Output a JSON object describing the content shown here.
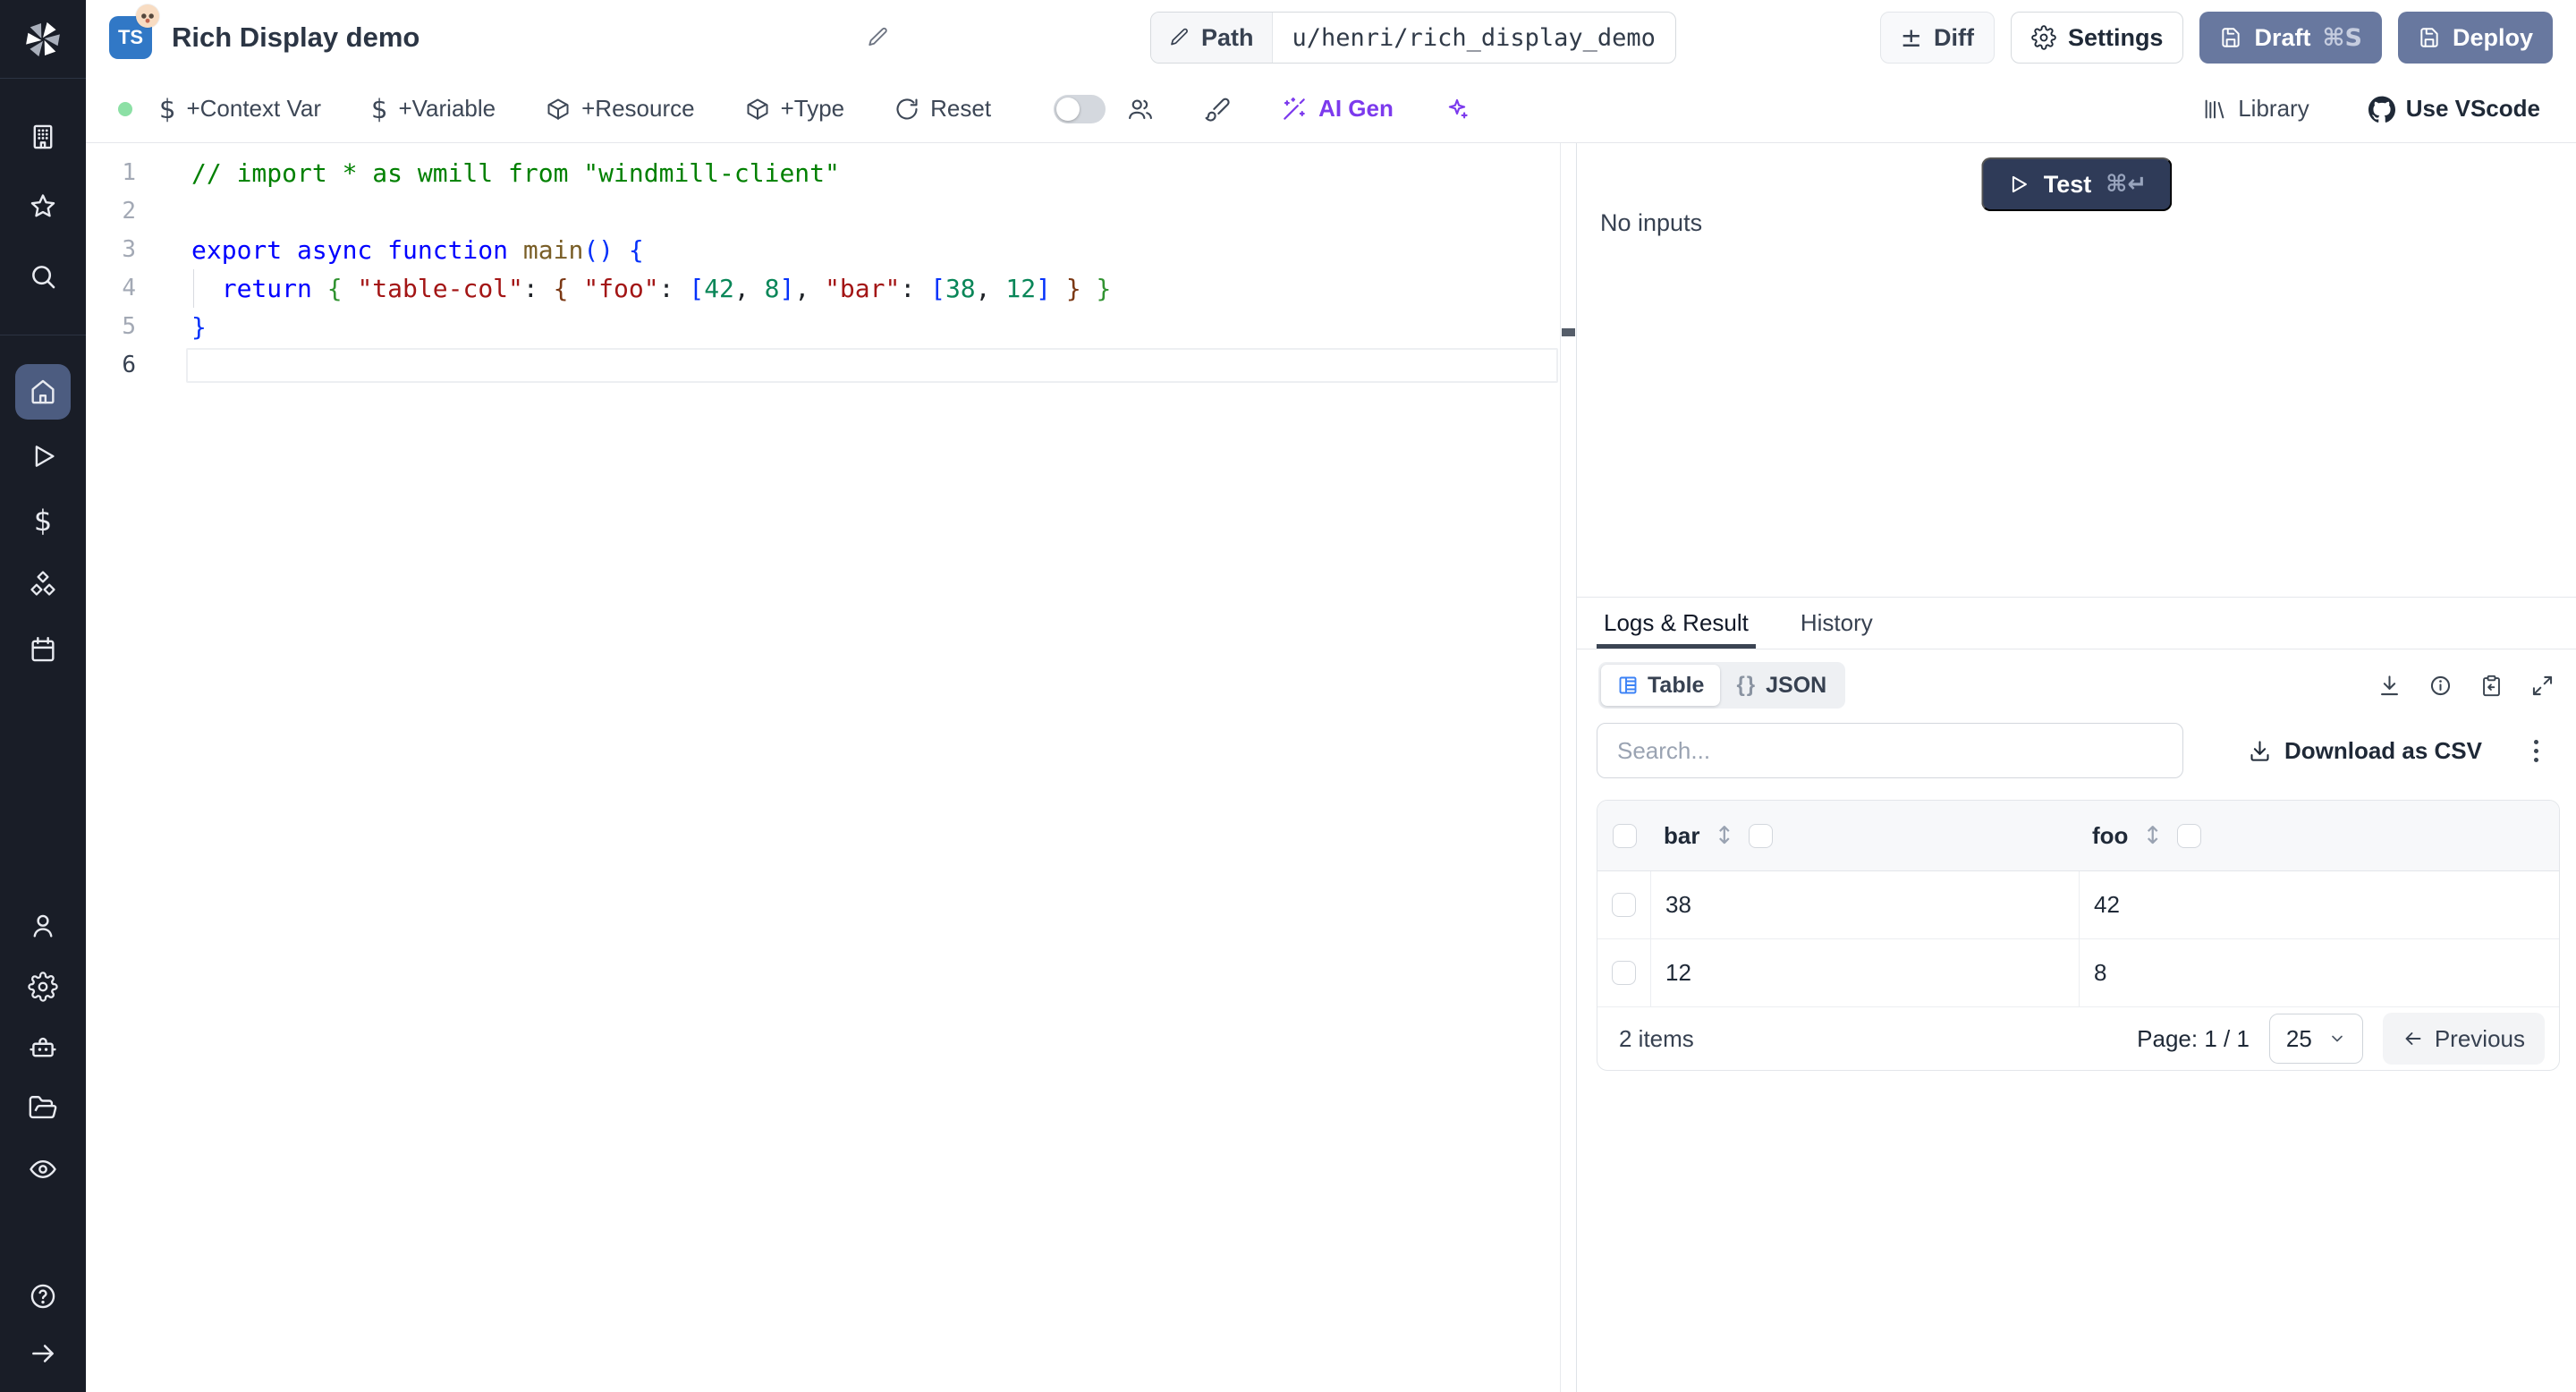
{
  "header": {
    "language_badge": "TS",
    "title": "Rich Display demo",
    "path_label": "Path",
    "path_value": "u/henri/rich_display_demo",
    "diff_label": "Diff",
    "settings_label": "Settings",
    "draft_label": "Draft",
    "draft_shortcut": "⌘S",
    "deploy_label": "Deploy"
  },
  "toolbar": {
    "context_var_label": "+Context Var",
    "variable_label": "+Variable",
    "resource_label": "+Resource",
    "type_label": "+Type",
    "reset_label": "Reset",
    "ai_gen_label": "AI Gen",
    "library_label": "Library",
    "use_vscode_label": "Use VScode",
    "assistant_toggle_on": false
  },
  "sidebar": {
    "icons_top": [
      "building",
      "star",
      "search"
    ],
    "icons_main": [
      "home",
      "play",
      "dollar",
      "cubes",
      "calendar"
    ],
    "active_icon": "home",
    "icons_lower": [
      "user",
      "gear",
      "robot",
      "folder",
      "eye"
    ],
    "icons_bottom": [
      "help",
      "arrow-right"
    ]
  },
  "editor": {
    "active_line": 6,
    "indent_guide_lines": [
      4
    ],
    "lines": [
      [
        {
          "text": "// import * as wmill from \"windmill-client\"",
          "color": "comment"
        }
      ],
      [],
      [
        {
          "text": "export async function",
          "color": "keyword"
        },
        {
          "text": " ",
          "color": "default"
        },
        {
          "text": "main",
          "color": "function"
        },
        {
          "text": "() {",
          "color": "bracket1"
        }
      ],
      [
        {
          "text": "  ",
          "color": "default"
        },
        {
          "text": "return",
          "color": "keyword"
        },
        {
          "text": " ",
          "color": "default"
        },
        {
          "text": "{",
          "color": "bracket2"
        },
        {
          "text": " ",
          "color": "default"
        },
        {
          "text": "\"table-col\"",
          "color": "string"
        },
        {
          "text": ": ",
          "color": "default"
        },
        {
          "text": "{",
          "color": "bracket3"
        },
        {
          "text": " ",
          "color": "default"
        },
        {
          "text": "\"foo\"",
          "color": "string"
        },
        {
          "text": ": ",
          "color": "default"
        },
        {
          "text": "[",
          "color": "bracket1"
        },
        {
          "text": "42",
          "color": "number"
        },
        {
          "text": ", ",
          "color": "default"
        },
        {
          "text": "8",
          "color": "number"
        },
        {
          "text": "]",
          "color": "bracket1"
        },
        {
          "text": ", ",
          "color": "default"
        },
        {
          "text": "\"bar\"",
          "color": "string"
        },
        {
          "text": ": ",
          "color": "default"
        },
        {
          "text": "[",
          "color": "bracket1"
        },
        {
          "text": "38",
          "color": "number"
        },
        {
          "text": ", ",
          "color": "default"
        },
        {
          "text": "12",
          "color": "number"
        },
        {
          "text": "]",
          "color": "bracket1"
        },
        {
          "text": " ",
          "color": "default"
        },
        {
          "text": "}",
          "color": "bracket3"
        },
        {
          "text": " ",
          "color": "default"
        },
        {
          "text": "}",
          "color": "bracket2"
        }
      ],
      [
        {
          "text": "}",
          "color": "bracket1"
        }
      ],
      []
    ]
  },
  "test_panel": {
    "test_label": "Test",
    "test_shortcut": "⌘↵",
    "no_inputs": "No inputs"
  },
  "results": {
    "tabs": [
      {
        "label": "Logs & Result",
        "active": true
      },
      {
        "label": "History",
        "active": false
      }
    ],
    "view": {
      "table_label": "Table",
      "json_glyph": "{}",
      "json_label": "JSON"
    },
    "search_placeholder": "Search...",
    "download_csv_label": "Download as CSV",
    "sort_glyph": "↕",
    "table": {
      "columns": [
        "bar",
        "foo"
      ],
      "rows": [
        [
          "38",
          "42"
        ],
        [
          "12",
          "8"
        ]
      ],
      "items_count": "2 items",
      "page_label": "Page: 1 / 1",
      "page_size": "25",
      "previous_label": "Previous"
    }
  },
  "colors": {
    "primary_button": "#68789f",
    "test_button": "#2f3b58",
    "ai_purple": "#7c3aed",
    "status_green": "#8ce0a5",
    "ts_badge_blue": "#3178c6",
    "table_view_icon_blue": "#3b82f6",
    "sidebar_bg": "#191d27",
    "sidebar_active": "#4c5c80",
    "code_comment": "#008000",
    "code_keyword": "#0000ff",
    "code_string": "#a31515",
    "code_number": "#098658",
    "code_function": "#795e26"
  }
}
